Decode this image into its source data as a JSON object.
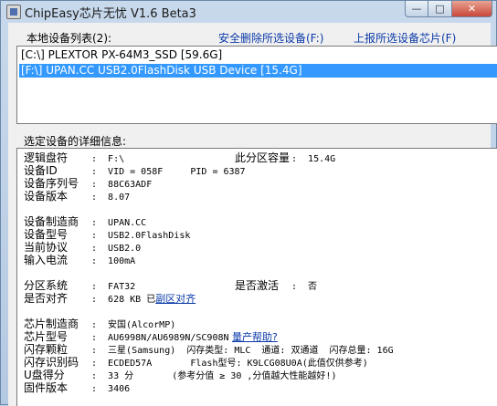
{
  "window": {
    "title": "ChipEasy芯片无忧 V1.6 Beta3",
    "min_glyph": "—",
    "max_glyph": "□",
    "close_glyph": "✕"
  },
  "devices": {
    "label": "本地设备列表(2):",
    "safe_remove": "安全删除所选设备(F:)",
    "report_chip": "上报所选设备芯片(F)",
    "items": [
      "[C:\\] PLEXTOR PX-64M3_SSD [59.6G]",
      "[F:\\] UPAN.CC USB2.0FlashDisk USB Device [15.4G]"
    ]
  },
  "details": {
    "label": "选定设备的详细信息:",
    "logical_drive": {
      "key": "逻辑盘符",
      "value": ":  F:\\"
    },
    "partition_cap": {
      "key": "此分区容量",
      "value": ":  15.4G"
    },
    "device_id": {
      "key": "设备ID",
      "value": ":  VID = 058F     PID = 6387"
    },
    "serial": {
      "key": "设备序列号",
      "value": ":  88C63ADF"
    },
    "version": {
      "key": "设备版本",
      "value": ":  8.07"
    },
    "vendor": {
      "key": "设备制造商",
      "value": ":  UPAN.CC"
    },
    "model": {
      "key": "设备型号",
      "value": ":  USB2.0FlashDisk"
    },
    "protocol": {
      "key": "当前协议",
      "value": ":  USB2.0"
    },
    "current": {
      "key": "输入电流",
      "value": ":  100mA"
    },
    "fs": {
      "key": "分区系统",
      "value": ":  FAT32"
    },
    "activated": {
      "key": "是否激活",
      "value": ":  否"
    },
    "aligned": {
      "key": "是否对齐",
      "value": ":  628 KB 已",
      "link": "副区对齐"
    },
    "chip_vendor": {
      "key": "芯片制造商",
      "value": ":  安国(AlcorMP)"
    },
    "chip_model": {
      "key": "芯片型号",
      "value": ":  AU6998N/AU6989N/SC908N",
      "link": "量产帮助?"
    },
    "flash": {
      "key": "闪存颗粒",
      "value": ":  三星(Samsung)  闪存类型: MLC  通道: 双通道  闪存总量: 16G"
    },
    "flash_id": {
      "key": "闪存识别码",
      "value": ":  ECDED57A       Flash型号: K9LCG08U0A(此值仅供参考)"
    },
    "score": {
      "key": "U盘得分",
      "value": ":  33 分       (参考分值 ≥ 30 ,分值越大性能越好!)"
    },
    "firmware": {
      "key": "固件版本",
      "value": ":  3406"
    }
  }
}
